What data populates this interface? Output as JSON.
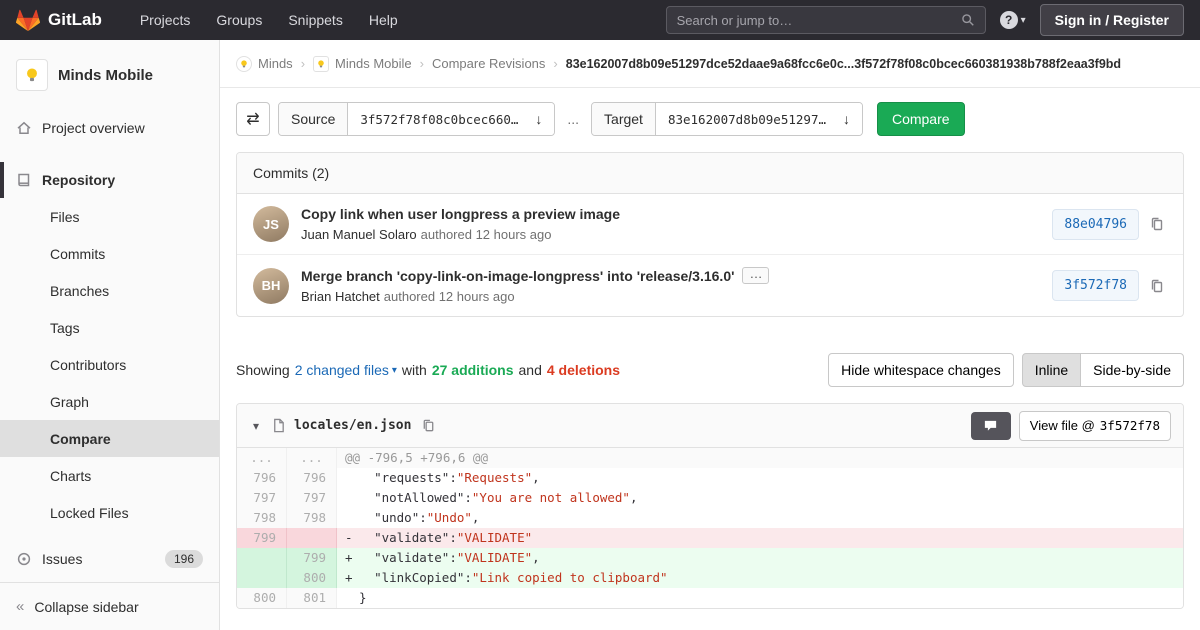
{
  "colors": {
    "accent_green": "#1aaa55",
    "link_blue": "#1b69b6",
    "deletion_red": "#db3b21",
    "removed_bg": "#fbe9eb",
    "added_bg": "#ecfdf0",
    "navbar_bg": "#2b2a30"
  },
  "navbar": {
    "brand": "GitLab",
    "links": [
      "Projects",
      "Groups",
      "Snippets",
      "Help"
    ],
    "search_placeholder": "Search or jump to…",
    "help_label": "?",
    "help_caret": "▾",
    "sign_in_label": "Sign in / Register"
  },
  "sidebar": {
    "project_name": "Minds Mobile",
    "project_overview": "Project overview",
    "repository_label": "Repository",
    "repo_items": [
      "Files",
      "Commits",
      "Branches",
      "Tags",
      "Contributors",
      "Graph",
      "Compare",
      "Charts",
      "Locked Files"
    ],
    "issues_label": "Issues",
    "issues_count": "196",
    "collapse_label": "Collapse sidebar",
    "collapse_icon": "«"
  },
  "breadcrumbs": {
    "group": "Minds",
    "project": "Minds Mobile",
    "page": "Compare Revisions",
    "separator": "›",
    "sha_range": "83e162007d8b09e51297dce52daae9a68fcc6e0c...3f572f78f08c0bcec660381938b788f2eaa3f9bd"
  },
  "compare_form": {
    "swap_icon": "⇄",
    "source_label": "Source",
    "source_value": "3f572f78f08c0bcec660…",
    "separator": "...",
    "target_label": "Target",
    "target_value": "83e162007d8b09e51297…",
    "dropdown_caret": "↓",
    "compare_button": "Compare"
  },
  "commits": {
    "header": "Commits (2)",
    "items": [
      {
        "title": "Copy link when user longpress a preview image",
        "author": "Juan Manuel Solaro",
        "meta": "authored 12 hours ago",
        "sha": "88e04796",
        "avatar_initials": "JS"
      },
      {
        "title": "Merge branch 'copy-link-on-image-longpress' into 'release/3.16.0'",
        "expand_label": "…",
        "author": "Brian Hatchet",
        "meta": "authored 12 hours ago",
        "sha": "3f572f78",
        "avatar_initials": "BH"
      }
    ]
  },
  "diff_summary": {
    "showing": "Showing",
    "files_link": "2 changed files",
    "files_caret": "▾",
    "with": "with",
    "additions": "27 additions",
    "and": "and",
    "deletions": "4 deletions",
    "hide_whitespace": "Hide whitespace changes",
    "inline": "Inline",
    "side_by_side": "Side-by-side"
  },
  "diff_file": {
    "collapse_caret": "▾",
    "path": "locales/en.json",
    "view_file_label": "View file @",
    "view_file_sha": "3f572f78",
    "rows": [
      {
        "type": "hunk",
        "old": "...",
        "new": "...",
        "text": "@@ -796,5 +796,6 @@"
      },
      {
        "type": "context",
        "old": "796",
        "new": "796",
        "sign": "",
        "indent": "  ",
        "key": "\"requests\":",
        "value": "\"Requests\"",
        "tail": ","
      },
      {
        "type": "context",
        "old": "797",
        "new": "797",
        "sign": "",
        "indent": "  ",
        "key": "\"notAllowed\":",
        "value": "\"You are not allowed\"",
        "tail": ","
      },
      {
        "type": "context",
        "old": "798",
        "new": "798",
        "sign": "",
        "indent": "  ",
        "key": "\"undo\":",
        "value": "\"Undo\"",
        "tail": ","
      },
      {
        "type": "removed",
        "old": "799",
        "new": "",
        "sign": "-",
        "indent": "  ",
        "key": "\"validate\":",
        "value": "\"VALIDATE\"",
        "tail": ""
      },
      {
        "type": "added",
        "old": "",
        "new": "799",
        "sign": "+",
        "indent": "  ",
        "key": "\"validate\":",
        "value": "\"VALIDATE\"",
        "tail": ","
      },
      {
        "type": "added",
        "old": "",
        "new": "800",
        "sign": "+",
        "indent": "  ",
        "key": "\"linkCopied\":",
        "value": "\"Link copied to clipboard\"",
        "tail": ""
      },
      {
        "type": "context",
        "old": "800",
        "new": "801",
        "sign": "",
        "indent": "",
        "key": "",
        "value": "",
        "tail": "}"
      }
    ]
  }
}
